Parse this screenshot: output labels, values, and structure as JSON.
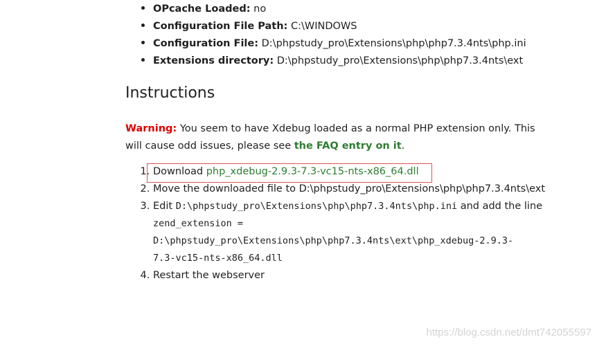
{
  "info": {
    "items": [
      {
        "key": "OPcache Loaded:",
        "value": "no"
      },
      {
        "key": "Configuration File Path:",
        "value": "C:\\WINDOWS"
      },
      {
        "key": "Configuration File:",
        "value": "D:\\phpstudy_pro\\Extensions\\php\\php7.3.4nts\\php.ini"
      },
      {
        "key": "Extensions directory:",
        "value": "D:\\phpstudy_pro\\Extensions\\php\\php7.3.4nts\\ext"
      }
    ]
  },
  "instructions": {
    "heading": "Instructions",
    "warning_label": "Warning:",
    "warning_text": "You seem to have Xdebug loaded as a normal PHP extension only. This will cause odd issues, please see",
    "faq_link": "the FAQ entry on it",
    "warning_end": ".",
    "steps": {
      "s1_prefix": "Download",
      "s1_link": "php_xdebug-2.9.3-7.3-vc15-nts-x86_64.dll",
      "s2": "Move the downloaded file to D:\\phpstudy_pro\\Extensions\\php\\php7.3.4nts\\ext",
      "s3_prefix": "Edit",
      "s3_path": "D:\\phpstudy_pro\\Extensions\\php\\php7.3.4nts\\php.ini",
      "s3_suffix": "and add the line",
      "s3_code_1": "zend_extension =",
      "s3_code_2": "D:\\phpstudy_pro\\Extensions\\php\\php7.3.4nts\\ext\\php_xdebug-2.9.3-",
      "s3_code_3": "7.3-vc15-nts-x86_64.dll",
      "s4": "Restart the webserver"
    }
  },
  "watermark": "https://blog.csdn.net/dmt742055597",
  "colors": {
    "warning": "#e00000",
    "link": "#2e7d32",
    "highlight_box": "#d9534f"
  }
}
